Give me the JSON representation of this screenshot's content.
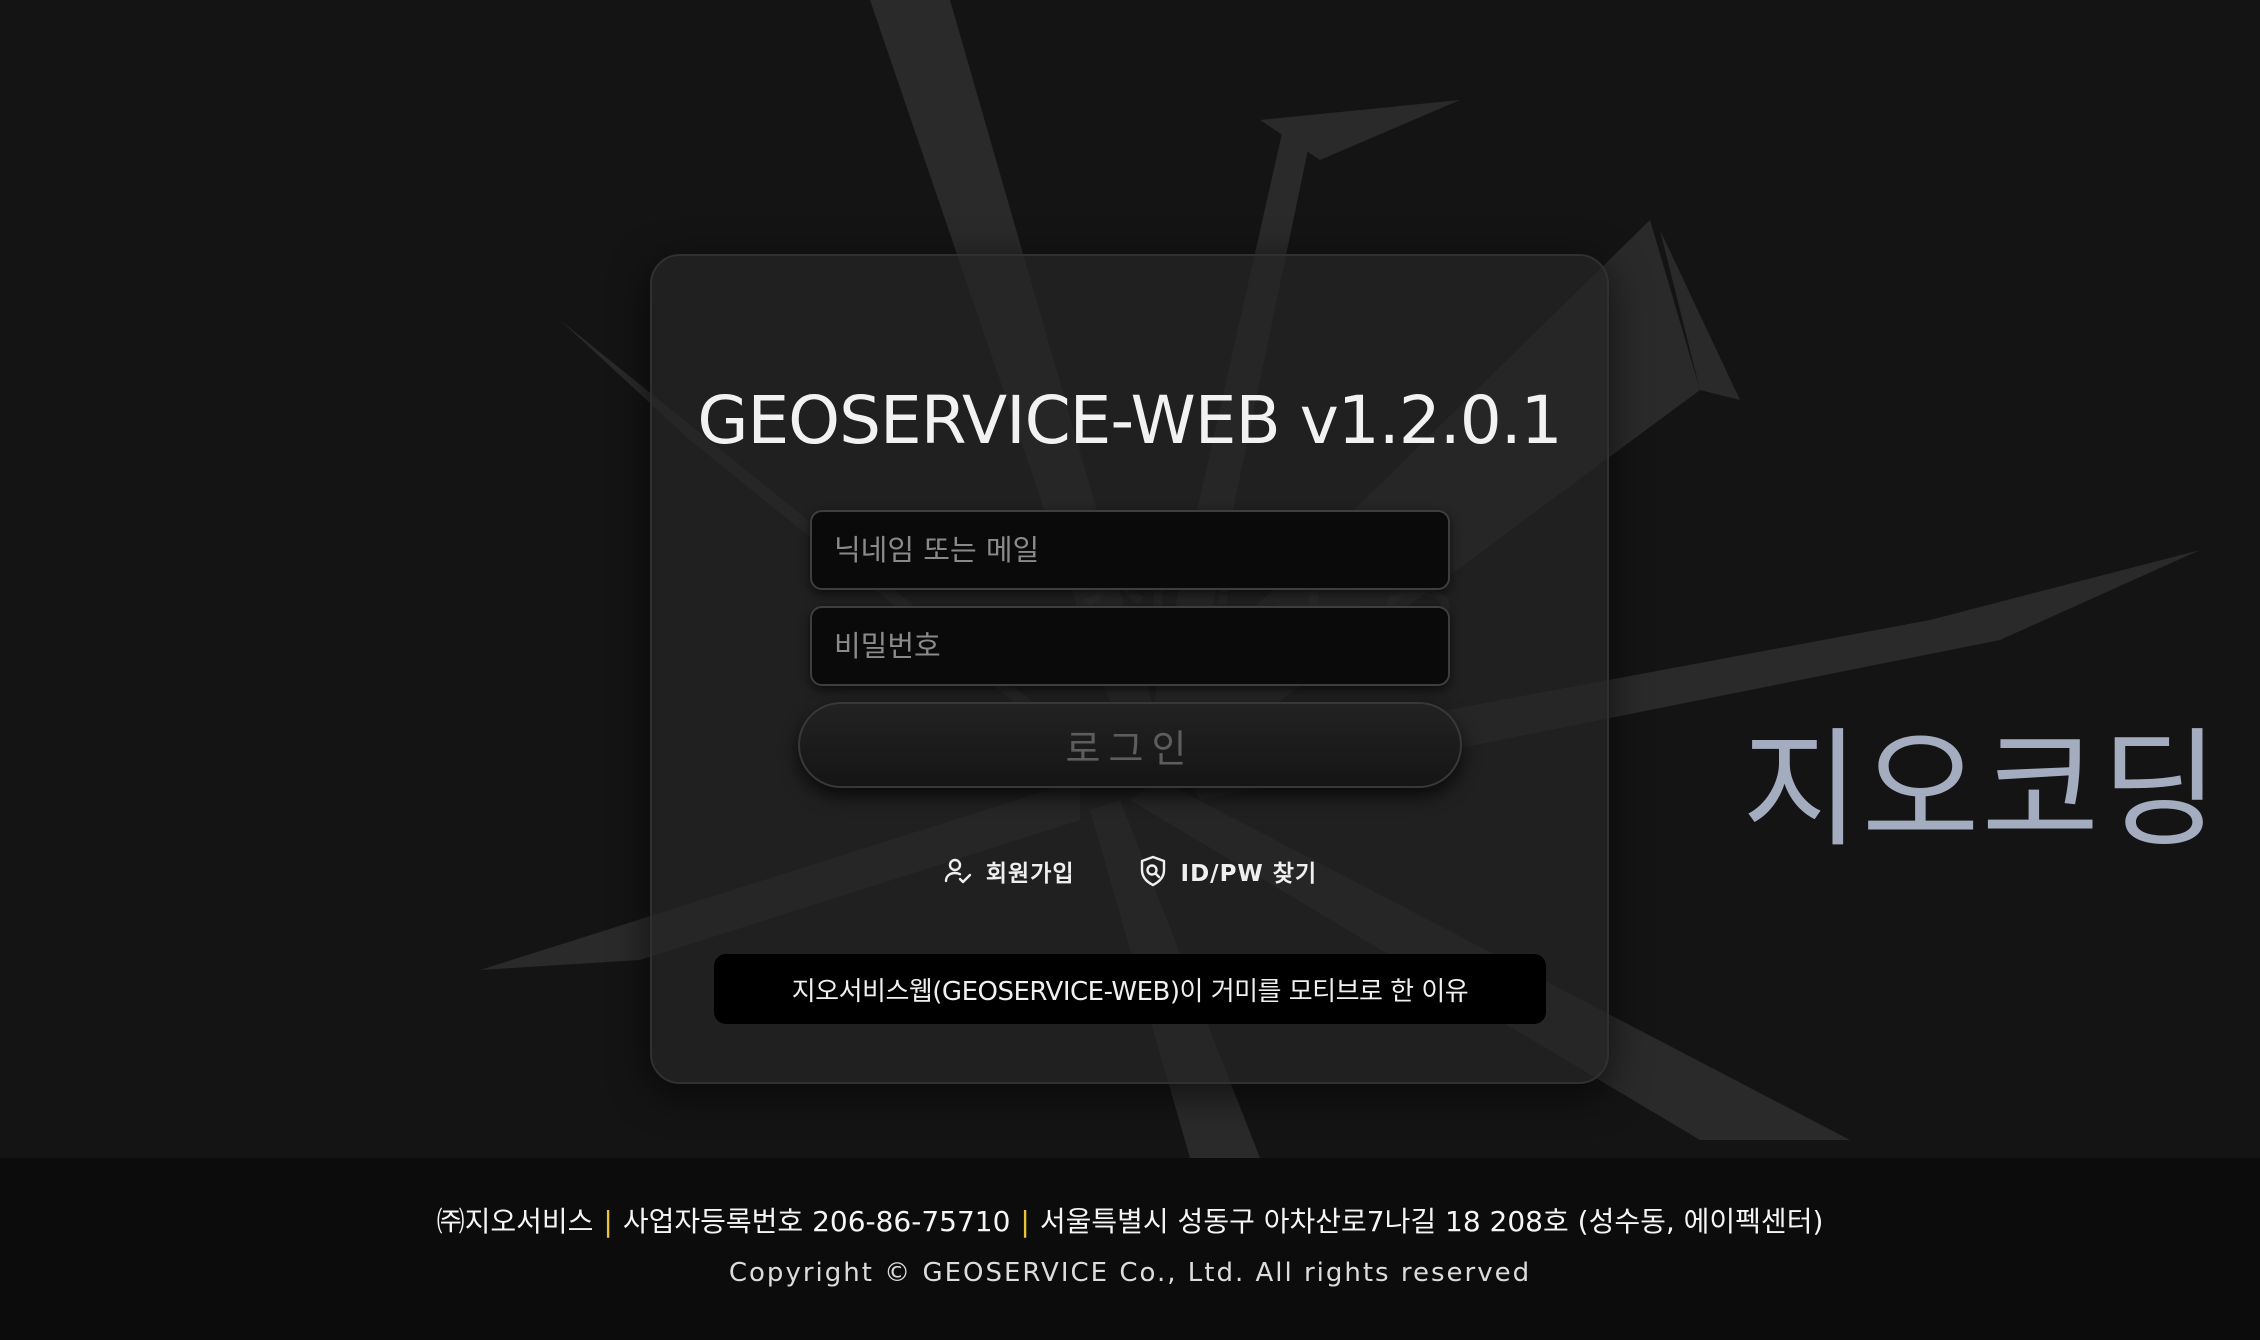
{
  "brand": {
    "watermark_text": "지오코딩",
    "watermark_color": "#a4acc0"
  },
  "login": {
    "title": "GEOSERVICE-WEB v1.2.0.1",
    "id_placeholder": "닉네임 또는 메일",
    "password_placeholder": "비밀번호",
    "login_label": "로그인",
    "signup_label": "회원가입",
    "signup_icon": "user-check-icon",
    "find_label": "ID/PW 찾기",
    "find_icon": "shield-search-icon",
    "banner_text": "지오서비스웹(GEOSERVICE-WEB)이 거미를 모티브로 한 이유"
  },
  "footer": {
    "company": "㈜지오서비스",
    "separator": "|",
    "business_number": "사업자등록번호 206-86-75710",
    "address": "서울특별시 성동구 아차산로7나길 18 208호 (성수동, 에이펙센터)",
    "copyright": "Copyright © GEOSERVICE Co., Ltd. All rights reserved",
    "separator_color": "#e8c33a"
  }
}
